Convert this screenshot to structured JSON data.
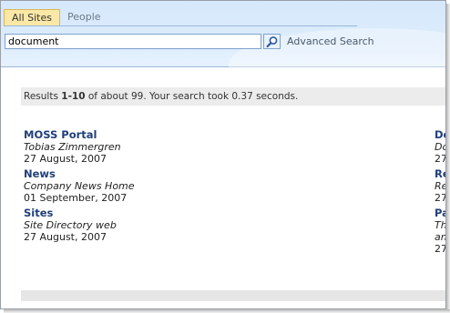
{
  "tabs": [
    {
      "label": "All Sites",
      "active": true
    },
    {
      "label": "People",
      "active": false
    }
  ],
  "search": {
    "value": "document",
    "button_icon": "magnifier-icon",
    "advanced_label": "Advanced Search"
  },
  "results_summary": {
    "prefix": "Results ",
    "range": "1-10",
    "suffix": " of about 99. Your search took 0.37 seconds."
  },
  "results_left": [
    {
      "title": "MOSS Portal",
      "description": "Tobias Zimmergren",
      "date": "27 August, 2007"
    },
    {
      "title": "News",
      "description": "Company News Home",
      "date": "01 September, 2007"
    },
    {
      "title": "Sites",
      "description": "Site Directory web",
      "date": "27 August, 2007"
    }
  ],
  "results_right_partial": [
    {
      "title": "Do",
      "line2": "Do",
      "line3": "27"
    },
    {
      "title": "Re",
      "line2": "Re",
      "line3": "27"
    },
    {
      "title": "Pa",
      "line2": "Th",
      "line3": "an",
      "line4": "27"
    }
  ],
  "colors": {
    "header_bg": "#dcecfc",
    "active_tab": "#fbe8a6",
    "link_title": "#1f3f7a"
  }
}
